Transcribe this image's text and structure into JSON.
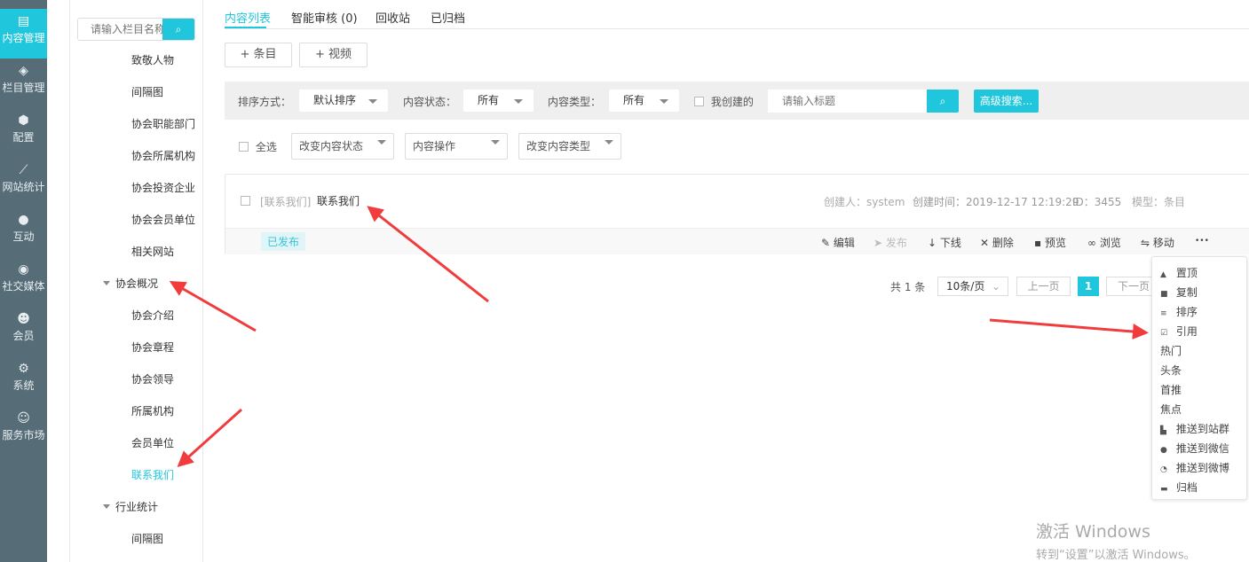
{
  "sidebar": {
    "items": [
      {
        "label": "内容管理",
        "icon": "document-edit-icon",
        "active": true
      },
      {
        "label": "栏目管理",
        "icon": "layers-icon"
      },
      {
        "label": "配置",
        "icon": "cube-icon"
      },
      {
        "label": "网站统计",
        "icon": "line-chart-icon"
      },
      {
        "label": "互动",
        "icon": "chat-bubbles-icon"
      },
      {
        "label": "社交媒体",
        "icon": "target-icon"
      },
      {
        "label": "会员",
        "icon": "user-check-icon"
      },
      {
        "label": "系统",
        "icon": "gear-icon"
      },
      {
        "label": "服务市场",
        "icon": "headset-user-icon"
      }
    ]
  },
  "tree": {
    "search_placeholder": "请输入栏目名称",
    "items": [
      "致敬人物",
      "间隔图",
      "协会职能部门",
      "协会所属机构",
      "协会投资企业",
      "协会会员单位",
      "相关网站"
    ],
    "group1": "协会概况",
    "group1_items": [
      "协会介绍",
      "协会章程",
      "协会领导",
      "所属机构",
      "会员单位",
      "联系我们"
    ],
    "selected": "联系我们",
    "group2": "行业统计",
    "group2_items": [
      "间隔图"
    ]
  },
  "tabs": [
    "内容列表",
    "智能审核 (0)",
    "回收站",
    "已归档"
  ],
  "toolbar": {
    "add_item": "+ 条目",
    "add_video": "+ 视频"
  },
  "filter": {
    "sort_label": "排序方式：",
    "sort_value": "默认排序",
    "status_label": "内容状态：",
    "status_value": "所有",
    "type_label": "内容类型：",
    "type_value": "所有",
    "mine_label": "我创建的",
    "search_placeholder": "请输入标题",
    "advanced": "高级搜索..."
  },
  "batch": {
    "select_all": "全选",
    "change_status": "改变内容状态",
    "operations": "内容操作",
    "change_type": "改变内容类型"
  },
  "item": {
    "channel": "[联系我们]",
    "title": "联系我们",
    "creator": "创建人：system",
    "created": "创建时间：2019-12-17 12:19:29",
    "id": "ID：3455",
    "model": "模型：条目",
    "status": "已发布",
    "actions": [
      "编辑",
      "发布",
      "下线",
      "删除",
      "预览",
      "浏览",
      "移动"
    ],
    "more": "•••"
  },
  "pagination": {
    "total": "共 1 条",
    "page_size": "10条/页",
    "prev": "上一页",
    "current": "1",
    "next": "下一页"
  },
  "more_menu": [
    {
      "label": "置顶",
      "icon": "arrow-to-top-icon"
    },
    {
      "label": "复制",
      "icon": "copy-icon"
    },
    {
      "label": "排序",
      "icon": "sort-icon"
    },
    {
      "label": "引用",
      "icon": "quote-check-icon"
    },
    {
      "label": "热门"
    },
    {
      "label": "头条"
    },
    {
      "label": "首推"
    },
    {
      "label": "焦点"
    },
    {
      "label": "推送到站群",
      "icon": "site-group-icon"
    },
    {
      "label": "推送到微信",
      "icon": "wechat-icon"
    },
    {
      "label": "推送到微博",
      "icon": "weibo-icon"
    },
    {
      "label": "归档",
      "icon": "archive-icon"
    }
  ],
  "watermark": {
    "line1": "激活 Windows",
    "line2": "转到“设置”以激活 Windows。"
  },
  "colors": {
    "accent": "#1fc6dc",
    "sidebar": "#566d78",
    "annotation": "#f03c3c"
  }
}
